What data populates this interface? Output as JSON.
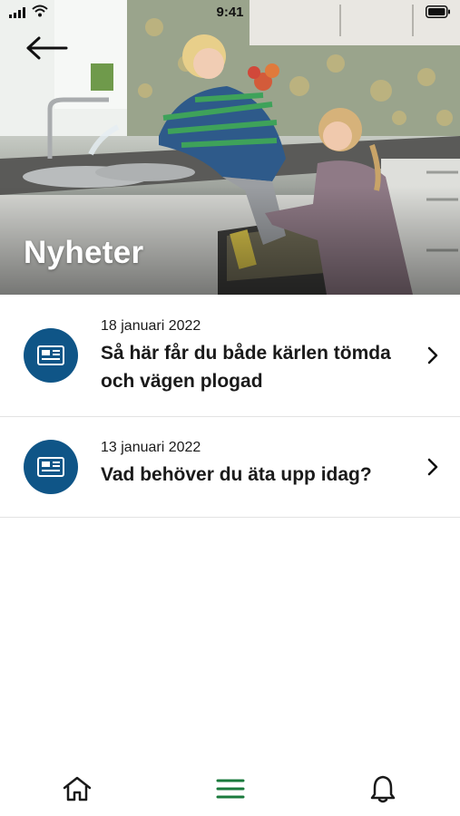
{
  "status_bar": {
    "time": "9:41"
  },
  "header": {
    "title": "Nyheter",
    "back_icon": "arrow-left-icon"
  },
  "news": [
    {
      "date": "18 januari 2022",
      "title": "Så här får du både kärlen tömda och vägen plogad",
      "icon": "newspaper-icon"
    },
    {
      "date": "13 januari 2022",
      "title": "Vad behöver du äta upp idag?",
      "icon": "newspaper-icon"
    }
  ],
  "tab_bar": {
    "items": [
      {
        "icon": "home-icon",
        "active": false
      },
      {
        "icon": "menu-icon",
        "active": true
      },
      {
        "icon": "bell-icon",
        "active": false
      }
    ]
  },
  "colors": {
    "badge": "#0f5587",
    "active_tab": "#1a7a3c",
    "text": "#1a1a1a"
  }
}
